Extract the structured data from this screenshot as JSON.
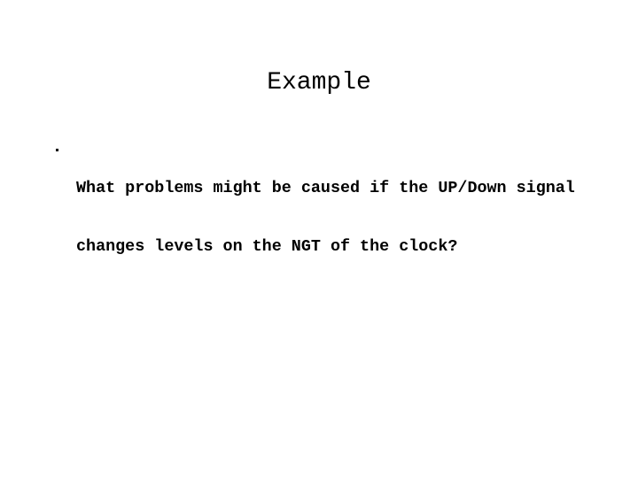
{
  "slide": {
    "background_color": "#ffffff",
    "text_color": "#000000",
    "title": "Example",
    "bullets": [
      {
        "marker": "bullet-dot",
        "text": "What problems might be caused if the UP/Down signal changes levels on the NGT of the clock?",
        "lines": [
          "What problems might be caused if the UP/Down signal",
          "changes levels on the NGT of the clock?"
        ]
      }
    ]
  }
}
